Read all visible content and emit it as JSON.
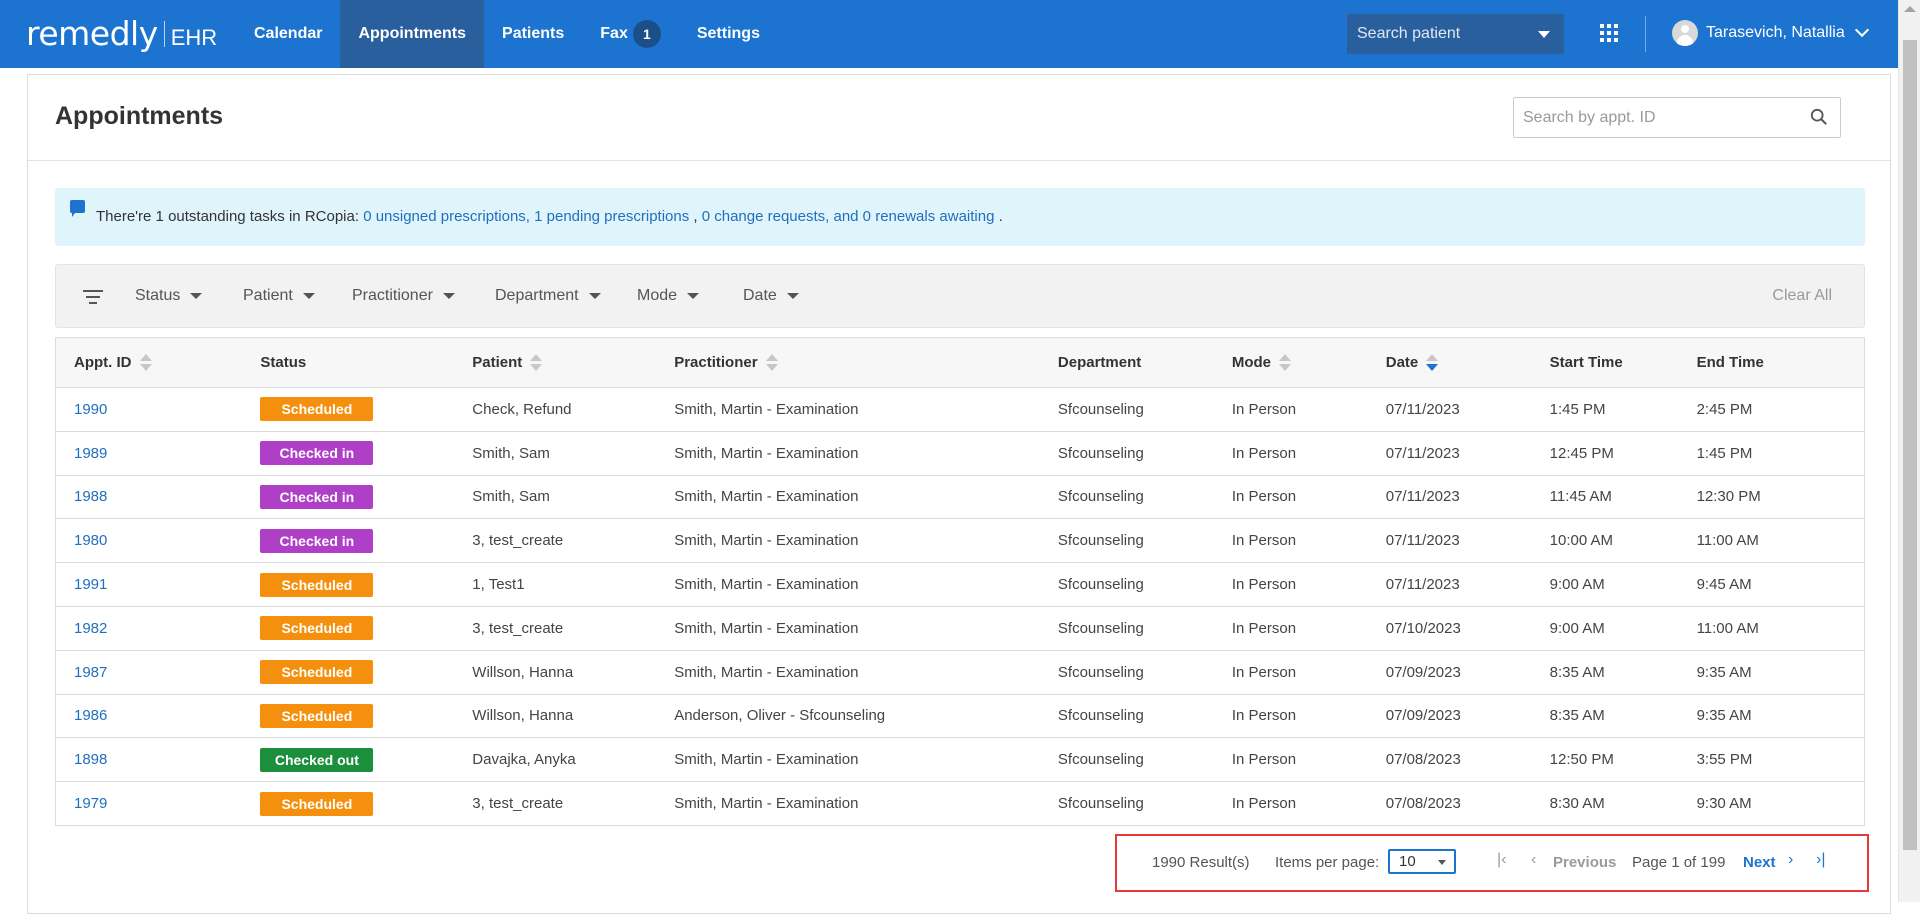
{
  "app": {
    "logo_main": "remedly",
    "logo_sub": "EHR",
    "nav": [
      {
        "label": "Calendar",
        "active": false
      },
      {
        "label": "Appointments",
        "active": true
      },
      {
        "label": "Patients",
        "active": false
      },
      {
        "label": "Fax",
        "active": false
      },
      {
        "label": "Settings",
        "active": false
      }
    ],
    "fax_badge": "1",
    "patient_search_placeholder": "Search patient",
    "user_name": "Tarasevich, Natallia"
  },
  "page": {
    "title": "Appointments",
    "appt_search_placeholder": "Search by appt. ID"
  },
  "alert": {
    "prefix": "There're 1 outstanding tasks in RCopia: ",
    "link1": "0 unsigned prescriptions, 1 pending prescriptions",
    "sep": " , ",
    "link2": "0 change requests, and 0 renewals awaiting",
    "suffix": " ."
  },
  "filters": {
    "items": [
      "Status",
      "Patient",
      "Practitioner",
      "Department",
      "Mode",
      "Date"
    ],
    "clear_all": "Clear All"
  },
  "table": {
    "columns": [
      "Appt. ID",
      "Status",
      "Patient",
      "Practitioner",
      "Department",
      "Mode",
      "Date",
      "Start Time",
      "End Time"
    ],
    "rows": [
      {
        "id": "1990",
        "status": "Scheduled",
        "patient": "Check, Refund",
        "practitioner": "Smith, Martin - Examination",
        "department": "Sfcounseling",
        "mode": "In Person",
        "date": "07/11/2023",
        "start": "1:45 PM",
        "end": "2:45 PM"
      },
      {
        "id": "1989",
        "status": "Checked in",
        "patient": "Smith, Sam",
        "practitioner": "Smith, Martin - Examination",
        "department": "Sfcounseling",
        "mode": "In Person",
        "date": "07/11/2023",
        "start": "12:45 PM",
        "end": "1:45 PM"
      },
      {
        "id": "1988",
        "status": "Checked in",
        "patient": "Smith, Sam",
        "practitioner": "Smith, Martin - Examination",
        "department": "Sfcounseling",
        "mode": "In Person",
        "date": "07/11/2023",
        "start": "11:45 AM",
        "end": "12:30 PM"
      },
      {
        "id": "1980",
        "status": "Checked in",
        "patient": "3, test_create",
        "practitioner": "Smith, Martin - Examination",
        "department": "Sfcounseling",
        "mode": "In Person",
        "date": "07/11/2023",
        "start": "10:00 AM",
        "end": "11:00 AM"
      },
      {
        "id": "1991",
        "status": "Scheduled",
        "patient": "1, Test1",
        "practitioner": "Smith, Martin - Examination",
        "department": "Sfcounseling",
        "mode": "In Person",
        "date": "07/11/2023",
        "start": "9:00 AM",
        "end": "9:45 AM"
      },
      {
        "id": "1982",
        "status": "Scheduled",
        "patient": "3, test_create",
        "practitioner": "Smith, Martin - Examination",
        "department": "Sfcounseling",
        "mode": "In Person",
        "date": "07/10/2023",
        "start": "9:00 AM",
        "end": "11:00 AM"
      },
      {
        "id": "1987",
        "status": "Scheduled",
        "patient": "Willson, Hanna",
        "practitioner": "Smith, Martin - Examination",
        "department": "Sfcounseling",
        "mode": "In Person",
        "date": "07/09/2023",
        "start": "8:35 AM",
        "end": "9:35 AM"
      },
      {
        "id": "1986",
        "status": "Scheduled",
        "patient": "Willson, Hanna",
        "practitioner": "Anderson, Oliver - Sfcounseling",
        "department": "Sfcounseling",
        "mode": "In Person",
        "date": "07/09/2023",
        "start": "8:35 AM",
        "end": "9:35 AM"
      },
      {
        "id": "1898",
        "status": "Checked out",
        "patient": "Davajka, Anyka",
        "practitioner": "Smith, Martin - Examination",
        "department": "Sfcounseling",
        "mode": "In Person",
        "date": "07/08/2023",
        "start": "12:50 PM",
        "end": "3:55 PM"
      },
      {
        "id": "1979",
        "status": "Scheduled",
        "patient": "3, test_create",
        "practitioner": "Smith, Martin - Examination",
        "department": "Sfcounseling",
        "mode": "In Person",
        "date": "07/08/2023",
        "start": "8:30 AM",
        "end": "9:30 AM"
      }
    ]
  },
  "status_colors": {
    "Scheduled": "#f5900e",
    "Checked in": "#b03fc7",
    "Checked out": "#1b8f3c"
  },
  "pagination": {
    "results": "1990 Result(s)",
    "items_per_page_label": "Items per page:",
    "items_per_page_value": "10",
    "previous": "Previous",
    "page_info": "Page 1 of 199",
    "next": "Next"
  }
}
